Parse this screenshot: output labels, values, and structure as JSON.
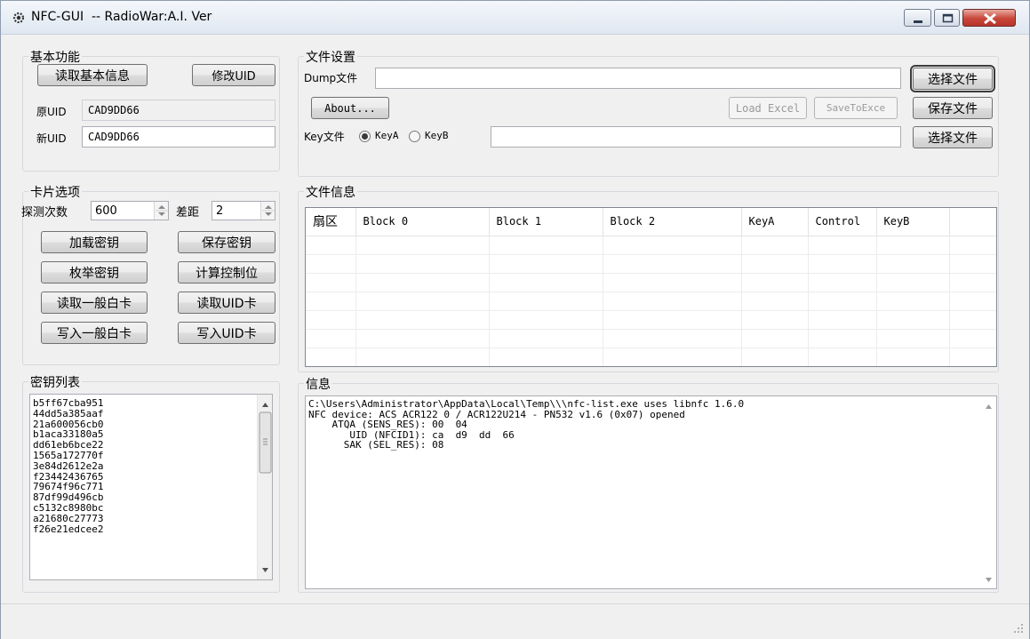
{
  "window": {
    "title": "NFC-GUI  -- RadioWar:A.I. Ver"
  },
  "basic": {
    "group_title": "基本功能",
    "read_info_label": "读取基本信息",
    "modify_uid_label": "修改UID",
    "orig_uid_label": "原UID",
    "orig_uid_value": "CAD9DD66",
    "new_uid_label": "新UID",
    "new_uid_value": "CAD9DD66"
  },
  "file_settings": {
    "group_title": "文件设置",
    "dump_label": "Dump文件",
    "dump_value": "",
    "select_file_label": "选择文件",
    "about_label": "About...",
    "load_excel_label": "Load Excel",
    "save_to_excel_label": "SaveToExce",
    "save_file_label": "保存文件",
    "key_file_label": "Key文件",
    "key_a_label": "KeyA",
    "key_b_label": "KeyB",
    "key_file_value": "",
    "select_key_file_label": "选择文件"
  },
  "card_options": {
    "group_title": "卡片选项",
    "probe_count_label": "探测次数",
    "probe_count_value": "600",
    "gap_label": "差距",
    "gap_value": "2",
    "load_keys_label": "加载密钥",
    "save_keys_label": "保存密钥",
    "enum_keys_label": "枚举密钥",
    "calc_control_label": "计算控制位",
    "read_normal_label": "读取一般白卡",
    "read_uid_label": "读取UID卡",
    "write_normal_label": "写入一般白卡",
    "write_uid_label": "写入UID卡"
  },
  "file_info": {
    "group_title": "文件信息",
    "columns": [
      "扇区",
      "Block 0",
      "Block 1",
      "Block 2",
      "KeyA",
      "Control",
      "KeyB",
      ""
    ]
  },
  "key_list": {
    "group_title": "密钥列表",
    "items": [
      "b5ff67cba951",
      "44dd5a385aaf",
      "21a600056cb0",
      "b1aca33180a5",
      "dd61eb6bce22",
      "1565a172770f",
      "3e84d2612e2a",
      "f23442436765",
      "79674f96c771",
      "87df99d496cb",
      "c5132c8980bc",
      "a21680c27773",
      "f26e21edcee2"
    ]
  },
  "info": {
    "group_title": "信息",
    "text": "C:\\Users\\Administrator\\AppData\\Local\\Temp\\\\\\nfc-list.exe uses libnfc 1.6.0\nNFC device: ACS ACR122 0 / ACR122U214 - PN532 v1.6 (0x07) opened\n    ATQA (SENS_RES): 00  04\n       UID (NFCID1): ca  d9  dd  66\n      SAK (SEL_RES): 08"
  },
  "colors": {
    "window_bg": "#f0f0f0",
    "close_button": "#c8463a"
  }
}
